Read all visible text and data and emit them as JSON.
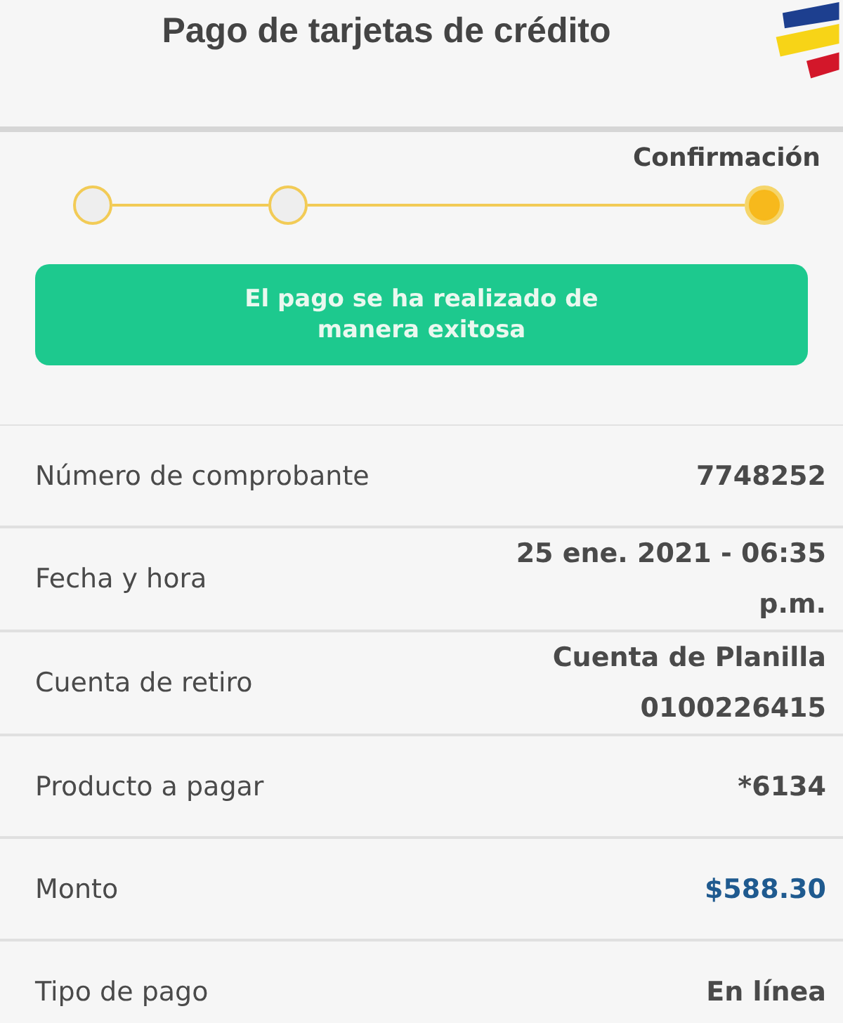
{
  "header": {
    "title": "Pago de tarjetas de crédito"
  },
  "stepper": {
    "steps": [
      {
        "selected": false
      },
      {
        "selected": false
      },
      {
        "selected": true,
        "label": "Confirmación"
      }
    ]
  },
  "banner": {
    "message": "El pago se ha realizado de manera exitosa"
  },
  "details": [
    {
      "label": "Número de comprobante",
      "value": "7748252",
      "kind": "plain"
    },
    {
      "label": "Fecha y hora",
      "value": "25 ene. 2021 - 06:35 p.m.",
      "kind": "plain"
    },
    {
      "label": "Cuenta de retiro",
      "value": "Cuenta de Planilla",
      "subvalue": "0100226415",
      "kind": "plain"
    },
    {
      "label": "Producto a pagar",
      "value": "*6134",
      "kind": "plain"
    },
    {
      "label": "Monto",
      "value": "$588.30",
      "kind": "amount"
    },
    {
      "label": "Tipo de pago",
      "value": "En línea",
      "kind": "plain"
    }
  ]
}
